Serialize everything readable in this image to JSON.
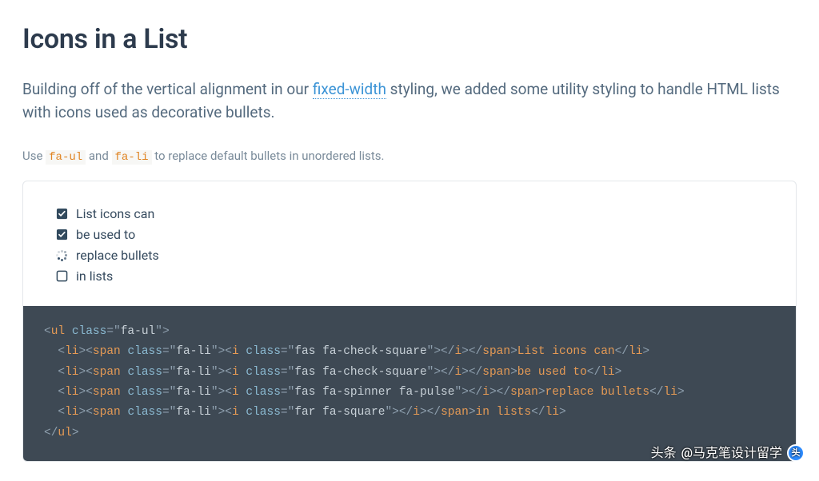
{
  "heading": "Icons in a List",
  "intro": {
    "pre": "Building off of the vertical alignment in our ",
    "link": "fixed-width",
    "post": " styling, we added some utility styling to handle HTML lists with icons used as decorative bullets."
  },
  "usage": {
    "pre": "Use ",
    "code1": "fa-ul",
    "mid": " and ",
    "code2": "fa-li",
    "post": " to replace default bullets in unordered lists."
  },
  "demo": {
    "items": [
      {
        "icon": "check-square-solid",
        "text": "List icons can"
      },
      {
        "icon": "check-square-solid",
        "text": "be used to"
      },
      {
        "icon": "spinner",
        "text": "replace bullets"
      },
      {
        "icon": "square-outline",
        "text": "in lists"
      }
    ]
  },
  "code": {
    "ul_class": "fa-ul",
    "li_span_class": "fa-li",
    "lines": [
      {
        "i_class": "fas fa-check-square",
        "text": "List icons can"
      },
      {
        "i_class": "fas fa-check-square",
        "text": "be used to"
      },
      {
        "i_class": "fas fa-spinner fa-pulse",
        "text": "replace bullets"
      },
      {
        "i_class": "far fa-square",
        "text": "in lists"
      }
    ]
  },
  "watermark": {
    "prefix": "头条",
    "handle": "@马克笔设计留学"
  }
}
